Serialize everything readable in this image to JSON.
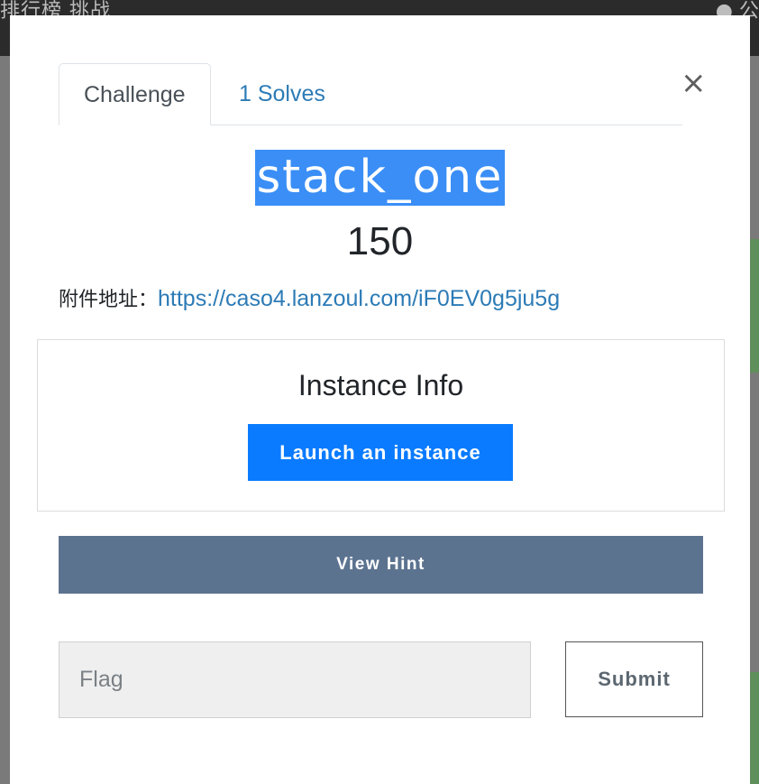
{
  "background": {
    "nav_text": "排行榜   挑战",
    "nav_right": "● 公"
  },
  "modal": {
    "tabs": [
      {
        "label": "Challenge",
        "active": true
      },
      {
        "label": "1 Solves",
        "active": false
      }
    ],
    "close_glyph": "×",
    "challenge_name": "stack_one",
    "points": "150",
    "attachment_label": "附件地址：",
    "attachment_url": "https://caso4.lanzoul.com/iF0EV0g5ju5g",
    "instance": {
      "title": "Instance Info",
      "launch_label": "Launch an instance"
    },
    "hint_label": "View Hint",
    "flag": {
      "placeholder": "Flag",
      "value": ""
    },
    "submit_label": "Submit"
  },
  "colors": {
    "title_highlight": "#3a8ef6",
    "link": "#2c7bb6",
    "launch_button": "#0a7bff",
    "hint_button": "#5c7390"
  }
}
